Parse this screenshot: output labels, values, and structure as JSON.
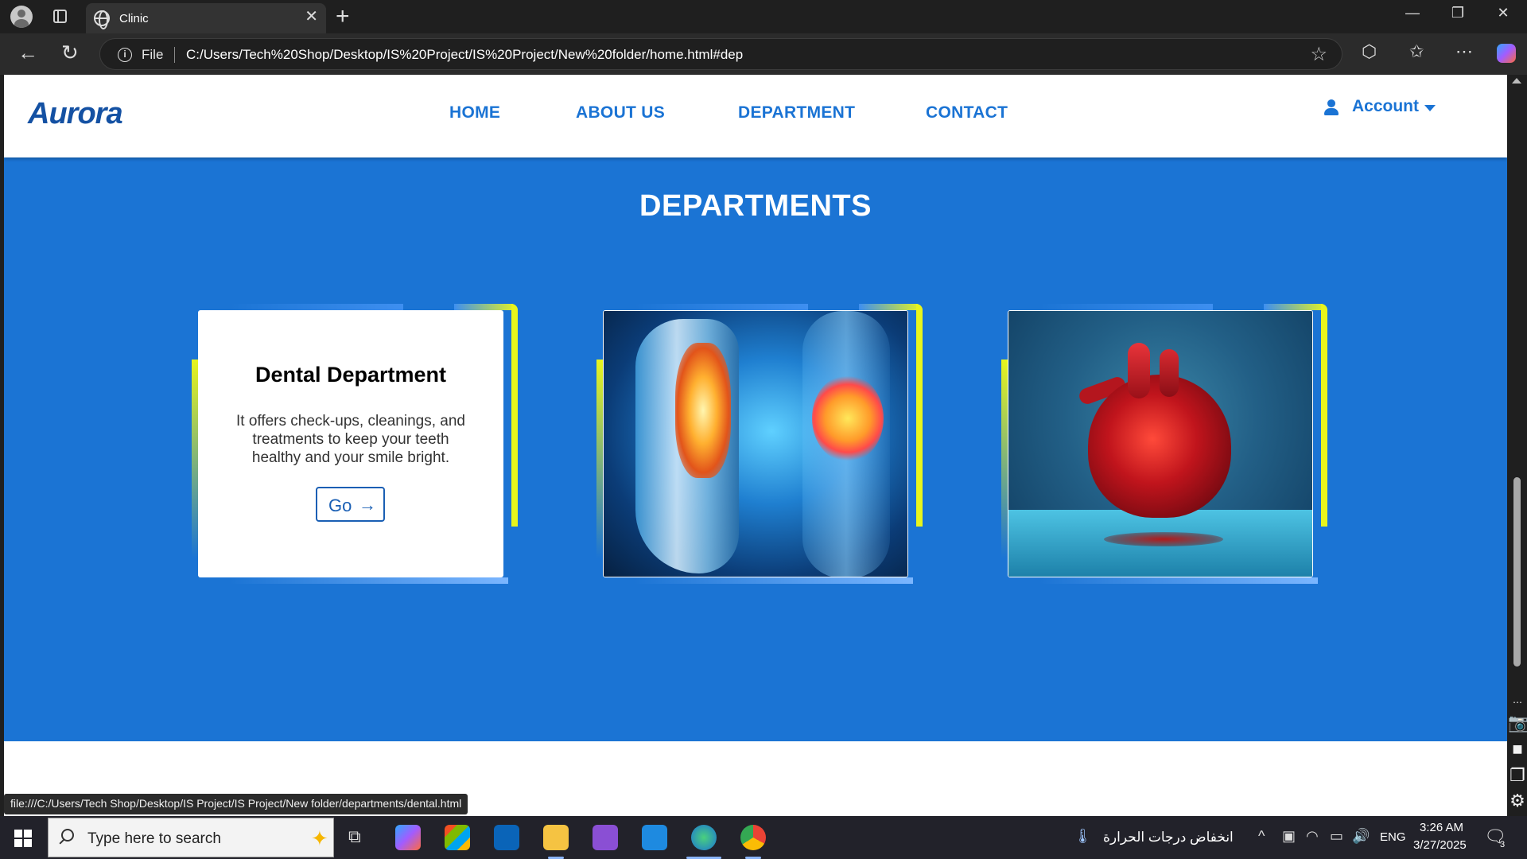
{
  "browser": {
    "tab_title": "Clinic",
    "tab_close": "✕",
    "new_tab": "+",
    "window_controls": {
      "minimize": "—",
      "restore": "❐",
      "close": "✕"
    },
    "address": {
      "scheme_label": "File",
      "url": "C:/Users/Tech%20Shop/Desktop/IS%20Project/IS%20Project/New%20folder/home.html#dep"
    },
    "status_link": "file:///C:/Users/Tech Shop/Desktop/IS Project/IS Project/New folder/departments/dental.html"
  },
  "site": {
    "logo": "Aurora",
    "nav": [
      {
        "label": "HOME"
      },
      {
        "label": "ABOUT US"
      },
      {
        "label": "DEPARTMENT"
      },
      {
        "label": "CONTACT"
      }
    ],
    "account_label": "Account",
    "brand_color": "#1b74d4",
    "accent_color": "#e8f51c"
  },
  "departments": {
    "title": "DEPARTMENTS",
    "cards": [
      {
        "heading": "Dental Department",
        "text": "It offers check-ups, cleanings, and treatments to keep your teeth healthy and your smile bright.",
        "button_label": "Go",
        "button_icon": "arrow-right-icon"
      },
      {
        "image": "knee-joint-xray-image"
      },
      {
        "image": "crystal-heart-image"
      }
    ]
  },
  "taskbar": {
    "search_placeholder": "Type here to search",
    "weather_text": "انخفاض درجات الحرارة",
    "language": "ENG",
    "time": "3:26 AM",
    "date": "3/27/2025",
    "notification_count": "3"
  }
}
